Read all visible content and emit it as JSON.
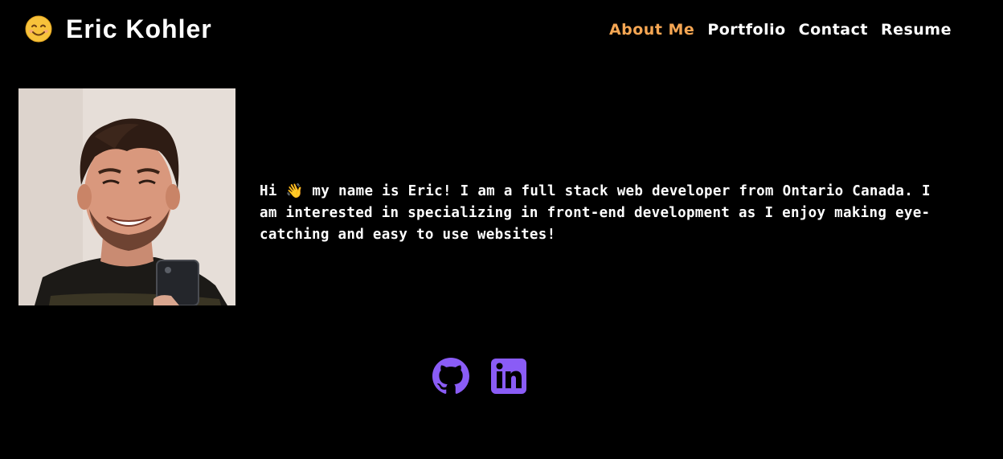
{
  "header": {
    "brand_emoji": "😊",
    "brand_name": "Eric Kohler",
    "nav": [
      {
        "label": "About Me",
        "active": true
      },
      {
        "label": "Portfolio",
        "active": false
      },
      {
        "label": "Contact",
        "active": false
      },
      {
        "label": "Resume",
        "active": false
      }
    ]
  },
  "about": {
    "bio": "Hi 👋 my name is Eric! I am a full stack web developer from Ontario Canada. I am interested in specializing in front-end development as I enjoy making eye-catching and easy to use websites!"
  },
  "socials": [
    {
      "icon": "github-icon"
    },
    {
      "icon": "linkedin-icon"
    }
  ],
  "colors": {
    "background": "#000000",
    "text": "#ffffff",
    "active_nav": "#f5a653",
    "social_icons": "#8a5cf6"
  }
}
